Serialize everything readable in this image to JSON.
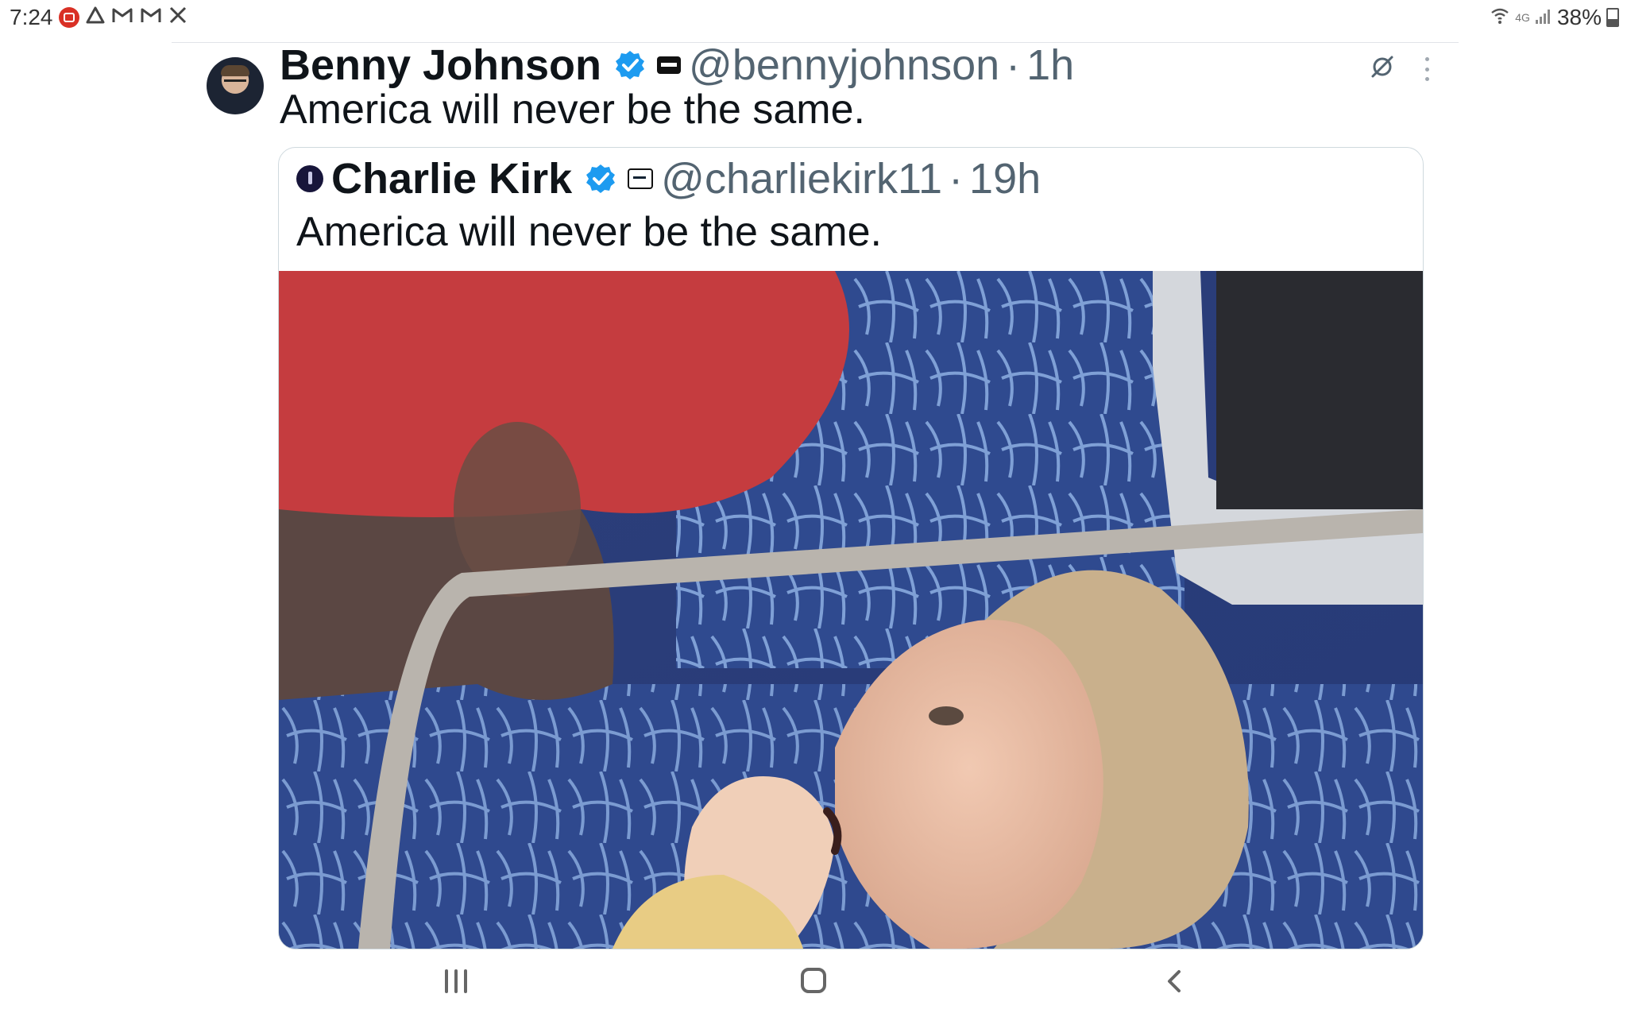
{
  "status_bar": {
    "time": "7:24",
    "notification_icons": [
      "news-badge-icon",
      "alert-triangle-icon",
      "gmail-icon",
      "gmail-icon",
      "x-logo-icon"
    ],
    "network": "4G",
    "battery": "38%"
  },
  "tweet": {
    "author_name": "Benny Johnson",
    "handle": "@bennyjohnson",
    "separator": "·",
    "time": "1h",
    "text": "America will never be the same."
  },
  "quoted_tweet": {
    "author_name": "Charlie Kirk",
    "handle": "@charliekirk11",
    "separator": "·",
    "time": "19h",
    "text": "America will never be the same."
  },
  "colors": {
    "verified_blue": "#1d9bf0",
    "secondary_text": "#536471",
    "primary_text": "#0f1419",
    "border": "#cfd9de"
  },
  "nav_bar": {
    "icons": [
      "recent-apps-icon",
      "home-icon",
      "back-icon"
    ]
  }
}
